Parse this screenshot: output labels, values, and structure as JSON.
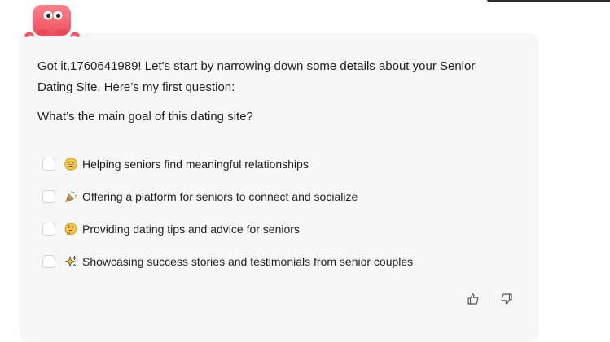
{
  "message": {
    "intro": "Got it,1760641989! Let's start by narrowing down some details about your Senior Dating Site. Here’s my first question:",
    "question": "What’s the main goal of this dating site?"
  },
  "options": [
    {
      "icon": "grinning-face-emoji",
      "label": "Helping seniors find meaningful relationships",
      "checked": false
    },
    {
      "icon": "party-popper-emoji",
      "label": "Offering a platform for seniors to connect and socialize",
      "checked": false
    },
    {
      "icon": "thinking-face-emoji",
      "label": "Providing dating tips and advice for seniors",
      "checked": false
    },
    {
      "icon": "sparkles-emoji",
      "label": "Showcasing success stories and testimonials from senior couples",
      "checked": false
    }
  ],
  "feedback": {
    "like_icon": "thumbs-up-icon",
    "dislike_icon": "thumbs-down-icon"
  },
  "colors": {
    "card_background": "#f7f7f7",
    "mascot": "#f45b66",
    "text": "#1f1f1f"
  }
}
